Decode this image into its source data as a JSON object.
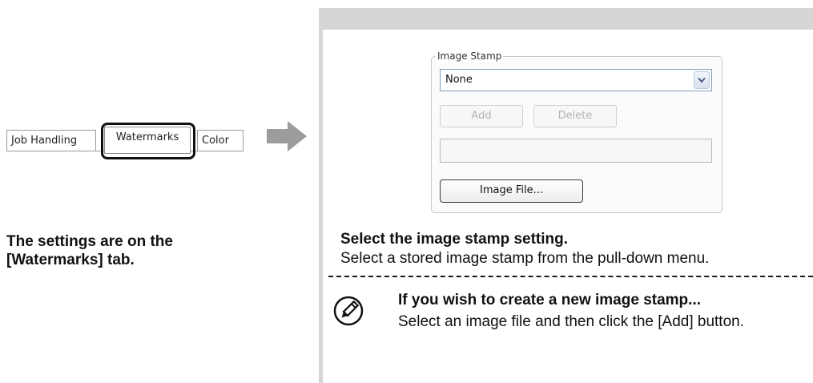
{
  "tabs": {
    "items": [
      {
        "label": "Job Handling"
      },
      {
        "label": "Watermarks"
      },
      {
        "label": "Color"
      }
    ]
  },
  "left_caption": {
    "line1": "The settings are on the",
    "line2": "[Watermarks] tab."
  },
  "dialog": {
    "group_title": "Image Stamp",
    "select_value": "None",
    "add_label": "Add",
    "delete_label": "Delete",
    "file_path_value": "",
    "image_file_label": "Image File..."
  },
  "instruction": {
    "title": "Select the image stamp setting.",
    "description": "Select a stored image stamp from the pull-down menu."
  },
  "note": {
    "icon": "pencil-note-icon",
    "title": "If you wish to create a new image stamp...",
    "body": "Select an image file and then click the [Add] button."
  },
  "colors": {
    "panel_gray": "#d6d6d6",
    "arrow_gray": "#9c9c9c",
    "text": "#111111"
  }
}
